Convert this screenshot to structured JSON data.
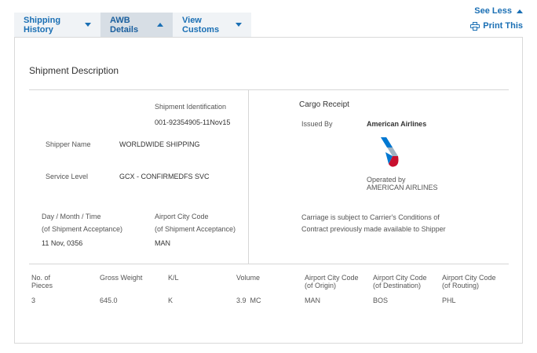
{
  "header": {
    "see_less": "See Less",
    "print": "Print This"
  },
  "tabs": [
    {
      "label": "Shipping History",
      "active": false
    },
    {
      "label": "AWB Details",
      "active": true
    },
    {
      "label": "View Customs",
      "active": false
    }
  ],
  "section": {
    "title": "Shipment Description"
  },
  "left": {
    "shipment_id_label": "Shipment Identification",
    "shipment_id_value": "001-92354905-11Nov15",
    "shipper_name_label": "Shipper Name",
    "shipper_name_value": "WORLDWIDE SHIPPING",
    "service_level_label": "Service Level",
    "service_level_value": "GCX - CONFIRMEDFS SVC",
    "acceptance_time_label_1": "Day / Month / Time",
    "acceptance_time_label_2": "(of Shipment Acceptance)",
    "acceptance_time_value": "11 Nov, 0356",
    "airport_label_1": "Airport City Code",
    "airport_label_2": "(of Shipment Acceptance)",
    "airport_value": "MAN"
  },
  "right": {
    "cargo_receipt": "Cargo Receipt",
    "issued_by_label": "Issued By",
    "issued_by_value": "American Airlines",
    "operated_by_1": "Operated by",
    "operated_by_2": "AMERICAN AIRLINES",
    "carriage_1": "Carriage is subject to Carrier's Conditions of",
    "carriage_2": "Contract previously made available to Shipper"
  },
  "summary": {
    "headers": {
      "pieces_1": "No. of",
      "pieces_2": "Pieces",
      "gross_weight": "Gross Weight",
      "kl": "K/L",
      "volume": "Volume",
      "origin_1": "Airport City Code",
      "origin_2": "(of Origin)",
      "destination_1": "Airport City Code",
      "destination_2": "(of Destination)",
      "routing_1": "Airport City Code",
      "routing_2": "(of Routing)"
    },
    "values": {
      "pieces": "3",
      "gross_weight": "645.0",
      "kl": "K",
      "volume": "3.9  MC",
      "origin": "MAN",
      "destination": "BOS",
      "routing": "PHL"
    }
  },
  "icons": {
    "see_less": "caret-up-icon",
    "print": "printer-icon",
    "tab_dropdown": "caret-down-icon",
    "logo": "american-airlines-logo"
  },
  "colors": {
    "link": "#1a6fb4",
    "tab_bg": "#f0f3f6",
    "tab_active_bg": "#d7dee5",
    "logo_red": "#c8102e",
    "logo_blue": "#0078d2"
  }
}
